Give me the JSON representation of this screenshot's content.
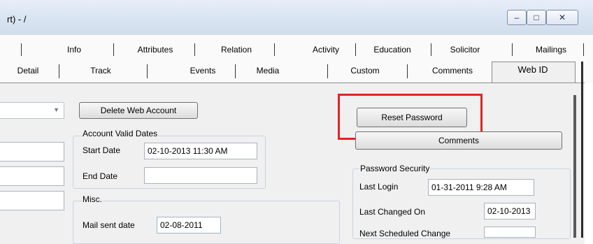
{
  "window": {
    "title_fragment": "rt) - /",
    "controls": {
      "minimize": "–",
      "maximize": "□",
      "close": "✕"
    }
  },
  "tabs_row1": [
    "Info",
    "Attributes",
    "Relation",
    "Activity",
    "Education",
    "Solicitor",
    "Mailings"
  ],
  "tabs_row2": [
    "Detail",
    "Track",
    "Events",
    "Media",
    "Custom",
    "Comments",
    "Web ID"
  ],
  "active_tab": "Web ID",
  "left": {
    "delete_button": "Delete Web Account"
  },
  "account_valid_dates": {
    "group_label": "Account Valid Dates",
    "start_date_label": "Start Date",
    "start_date_value": "02-10-2013 11:30 AM",
    "end_date_label": "End Date",
    "end_date_value": ""
  },
  "misc": {
    "group_label": "Misc.",
    "mail_sent_date_label": "Mail sent date",
    "mail_sent_date_value": "02-08-2011"
  },
  "right": {
    "reset_password_button": "Reset Password",
    "comments_button": "Comments"
  },
  "password_security": {
    "group_label": "Password Security",
    "last_login_label": "Last Login",
    "last_login_value": "01-31-2011 9:28 AM",
    "last_changed_label": "Last Changed On",
    "last_changed_value": "02-10-2013",
    "next_change_label": "Next Scheduled Change"
  },
  "colors": {
    "highlight": "#e02424",
    "panel": "#f0f0f0"
  }
}
